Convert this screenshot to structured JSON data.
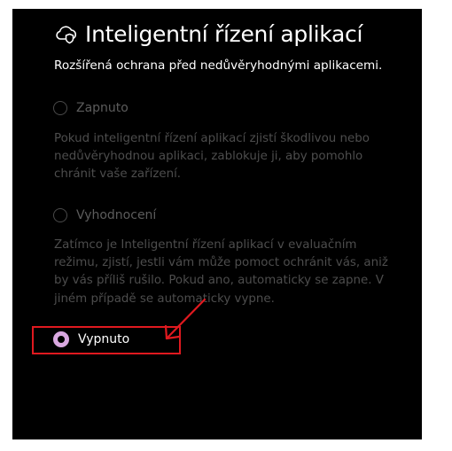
{
  "header": {
    "title": "Inteligentní řízení aplikací",
    "subtitle": "Rozšířená ochrana před nedůvěryhodnými aplikacemi.",
    "icon": "cloud-shield-icon"
  },
  "options": [
    {
      "label": "Zapnuto",
      "selected": false,
      "description": "Pokud inteligentní řízení aplikací zjistí škodlivou nebo nedůvěryhodnou aplikaci, zablokuje ji, aby pomohlo chránit vaše zařízení."
    },
    {
      "label": "Vyhodnocení",
      "selected": false,
      "description": "Zatímco je Inteligentní řízení aplikací v evaluačním režimu, zjistí, jestli vám může pomoct ochránit vás, aniž by vás příliš rušilo. Pokud ano, automaticky se zapne. V jiném případě se automaticky vypne."
    },
    {
      "label": "Vypnuto",
      "selected": true
    }
  ],
  "colors": {
    "accent": "#d9a8e0",
    "annotation": "#e0191f",
    "background": "#000000"
  }
}
